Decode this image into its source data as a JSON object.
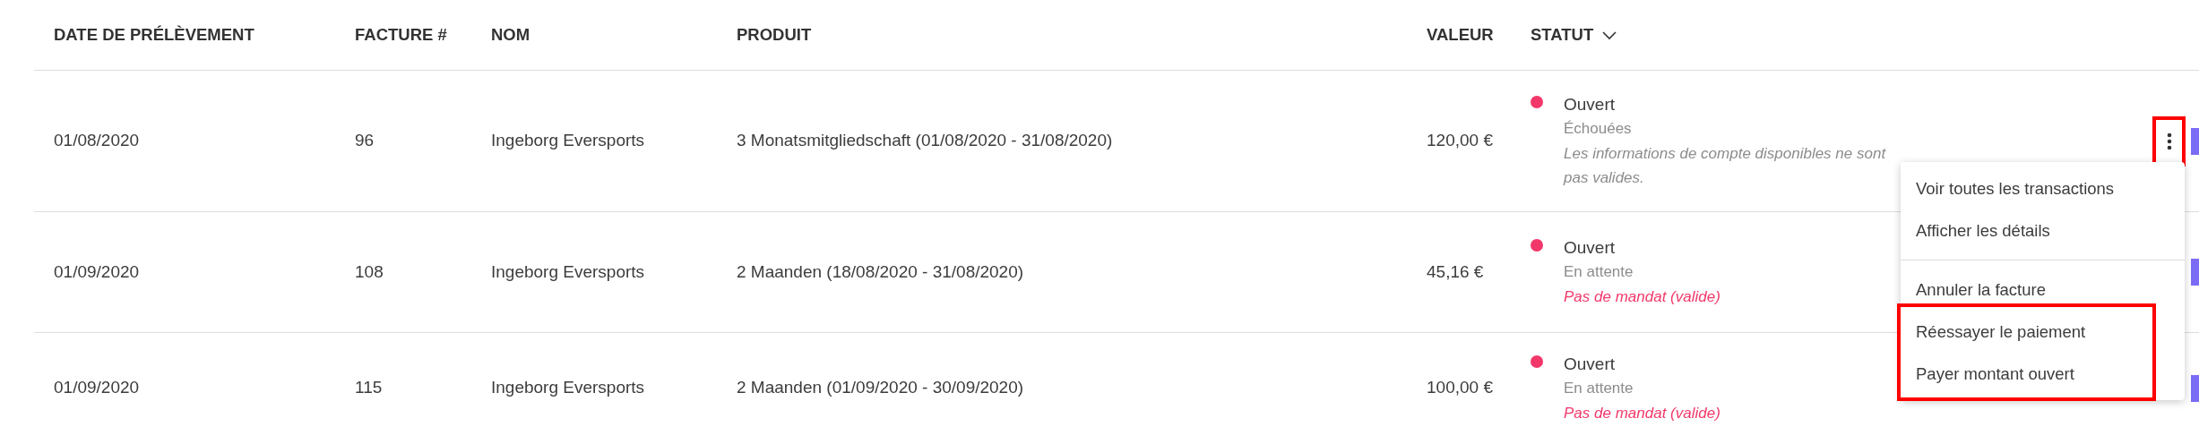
{
  "table": {
    "columns": [
      {
        "label": "DATE DE PRÉLÈVEMENT",
        "dropdown": false
      },
      {
        "label": "FACTURE #",
        "dropdown": false
      },
      {
        "label": "NOM",
        "dropdown": false
      },
      {
        "label": "PRODUIT",
        "dropdown": false
      },
      {
        "label": "VALEUR",
        "dropdown": false
      },
      {
        "label": "STATUT",
        "dropdown": true
      }
    ],
    "rows": [
      {
        "date": "01/08/2020",
        "invoice": "96",
        "name": "Ingeborg Eversports",
        "product": "3 Monatsmitgliedschaft (01/08/2020 - 31/08/2020)",
        "value": "120,00 €",
        "status": {
          "label": "Ouvert",
          "color": "#f2386a",
          "detail": "Échouées",
          "note": "Les informations de compte disponibles ne sont pas valides.",
          "note_error": false
        },
        "menu_button": {
          "highlighted": true
        }
      },
      {
        "date": "01/09/2020",
        "invoice": "108",
        "name": "Ingeborg Eversports",
        "product": "2 Maanden (18/08/2020 - 31/08/2020)",
        "value": "45,16 €",
        "status": {
          "label": "Ouvert",
          "color": "#f2386a",
          "detail": "En attente",
          "note": "Pas de mandat (valide)",
          "note_error": true
        }
      },
      {
        "date": "01/09/2020",
        "invoice": "115",
        "name": "Ingeborg Eversports",
        "product": "2 Maanden (01/09/2020 - 30/09/2020)",
        "value": "100,00 €",
        "status": {
          "label": "Ouvert",
          "color": "#f2386a",
          "detail": "En attente",
          "note": "Pas de mandat (valide)",
          "note_error": true
        }
      }
    ]
  },
  "context_menu": {
    "sections": [
      {
        "items": [
          {
            "label": "Voir toutes les transactions",
            "highlighted": false
          },
          {
            "label": "Afficher les détails",
            "highlighted": false
          }
        ]
      },
      {
        "items": [
          {
            "label": "Annuler la facture",
            "highlighted": false
          },
          {
            "label": "Réessayer le paiement",
            "highlighted": true
          },
          {
            "label": "Payer montant ouvert",
            "highlighted": true
          }
        ]
      }
    ]
  }
}
